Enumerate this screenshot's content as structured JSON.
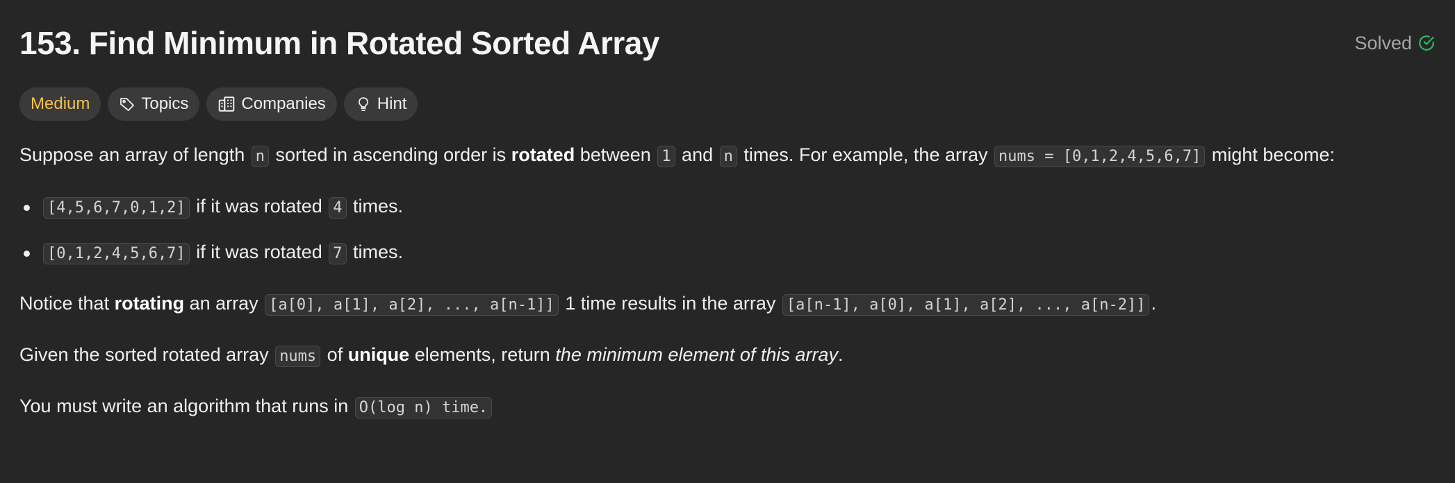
{
  "header": {
    "title": "153. Find Minimum in Rotated Sorted Array",
    "status": "Solved",
    "status_icon": "check-circle-icon",
    "status_color": "#2cbb5d"
  },
  "tags": {
    "difficulty": "Medium",
    "difficulty_color": "#f4c04a",
    "topics": "Topics",
    "companies": "Companies",
    "hint": "Hint"
  },
  "description": {
    "p1": {
      "t1": "Suppose an array of length ",
      "c1": "n",
      "t2": " sorted in ascending order is ",
      "b1": "rotated",
      "t3": " between ",
      "c2": "1",
      "t4": " and ",
      "c3": "n",
      "t5": " times. For example, the array ",
      "c4": "nums = [0,1,2,4,5,6,7]",
      "t6": " might become:"
    },
    "bullets": [
      {
        "code": "[4,5,6,7,0,1,2]",
        "t1": " if it was rotated ",
        "n": "4",
        "t2": " times."
      },
      {
        "code": "[0,1,2,4,5,6,7]",
        "t1": " if it was rotated ",
        "n": "7",
        "t2": " times."
      }
    ],
    "p2": {
      "t1": "Notice that ",
      "b1": "rotating",
      "t2": " an array ",
      "c1": "[a[0], a[1], a[2], ..., a[n-1]]",
      "t3": " 1 time results in the array ",
      "c2": "[a[n-1], a[0], a[1], a[2], ..., a[n-2]]",
      "t4": "."
    },
    "p3": {
      "t1": "Given the sorted rotated array ",
      "c1": "nums",
      "t2": " of ",
      "b1": "unique",
      "t3": " elements, return ",
      "i1": "the minimum element of this array",
      "t4": "."
    },
    "p4": {
      "t1": "You must write an algorithm that runs in ",
      "c1": "O(log n) time."
    }
  }
}
